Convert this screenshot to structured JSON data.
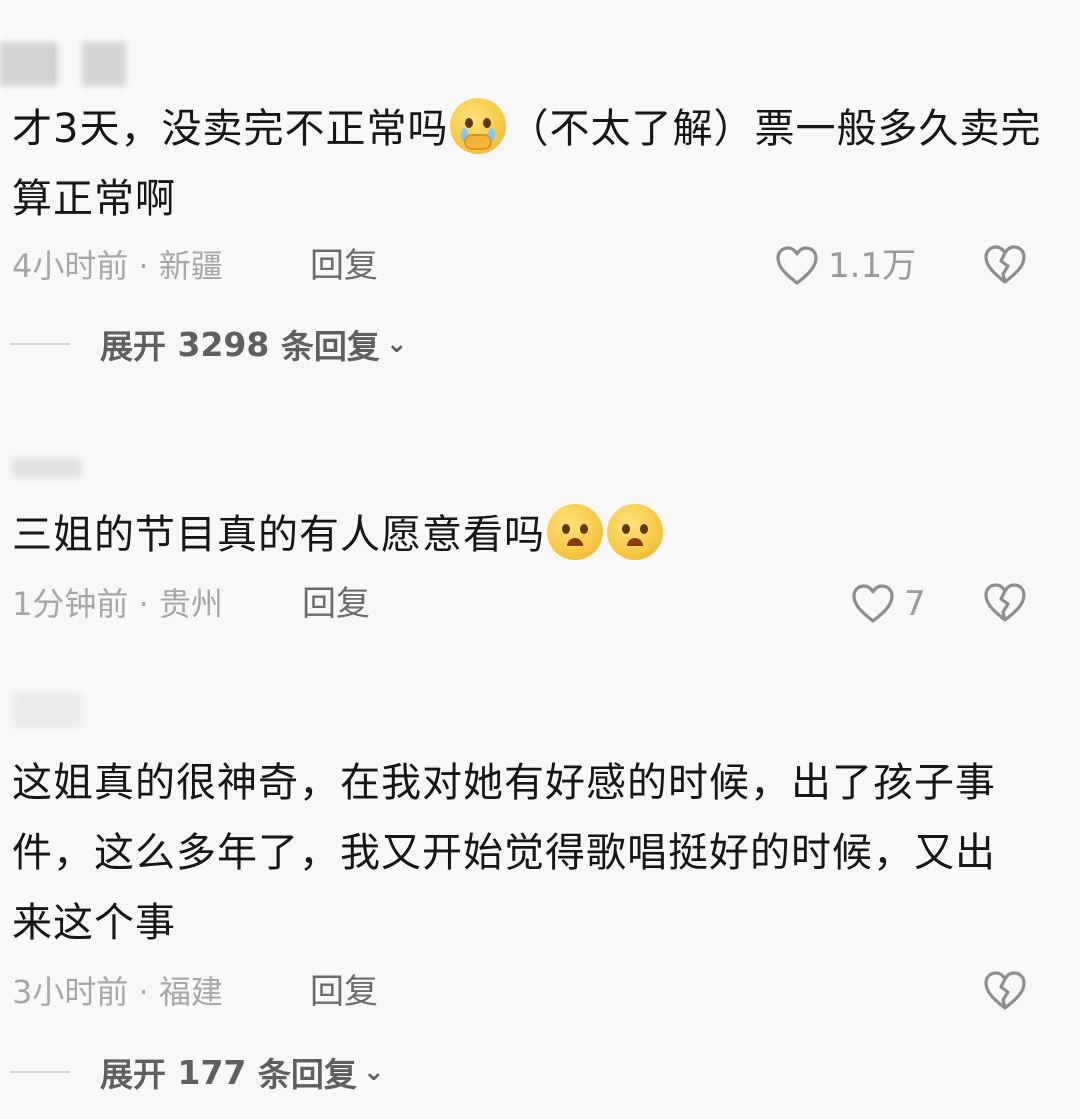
{
  "comments": [
    {
      "text_parts": [
        "才3天，没卖完不正常吗",
        "（不太了解）票一般多久卖完算正常啊"
      ],
      "emoji": "crying-face-hands-emoji",
      "time": "4小时前 · 新疆",
      "reply": "回复",
      "likes": "1.1万",
      "expand": {
        "prefix": "展开",
        "count": "3298",
        "suffix": "条回复"
      }
    },
    {
      "text": "三姐的节目真的有人愿意看吗",
      "emoji": "pleading-face-emoji",
      "time": "1分钟前 · 贵州",
      "reply": "回复",
      "likes": "7"
    },
    {
      "text": "这姐真的很神奇，在我对她有好感的时候，出了孩子事件，这么多年了，我又开始觉得歌唱挺好的时候，又出来这个事",
      "time": "3小时前 · 福建",
      "reply": "回复",
      "expand": {
        "prefix": "展开",
        "count": "177",
        "suffix": "条回复"
      }
    }
  ],
  "icons": {
    "like": "heart-outline-icon",
    "dislike": "broken-heart-icon",
    "chevron": "chevron-down-icon"
  },
  "colors": {
    "text": "#161616",
    "meta": "#a7a7a7",
    "reply": "#6b6b6b",
    "background": "#f8f8f8"
  }
}
